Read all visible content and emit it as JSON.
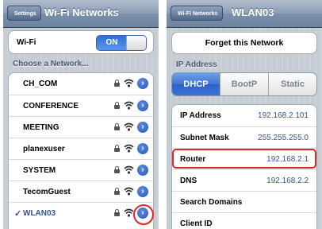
{
  "left": {
    "back_label": "Settings",
    "title": "Wi-Fi Networks",
    "wifi_label": "Wi-Fi",
    "wifi_toggle": "ON",
    "section_header": "Choose a Network...",
    "networks": [
      {
        "name": "CH_COM",
        "selected": false
      },
      {
        "name": "CONFERENCE",
        "selected": false
      },
      {
        "name": "MEETING",
        "selected": false
      },
      {
        "name": "planexuser",
        "selected": false
      },
      {
        "name": "SYSTEM",
        "selected": false
      },
      {
        "name": "TecomGuest",
        "selected": false
      },
      {
        "name": "WLAN03",
        "selected": true
      }
    ],
    "check_mark": "✓"
  },
  "right": {
    "back_label": "Wi-Fi Networks",
    "title": "WLAN03",
    "forget_button": "Forget this Network",
    "section_header": "IP Address",
    "segments": [
      "DHCP",
      "BootP",
      "Static"
    ],
    "active_segment": "DHCP",
    "rows": [
      {
        "label": "IP Address",
        "value": "192.168.2.101"
      },
      {
        "label": "Subnet Mask",
        "value": "255.255.255.0"
      },
      {
        "label": "Router",
        "value": "192.168.2.1"
      },
      {
        "label": "DNS",
        "value": "192.168.2.2"
      },
      {
        "label": "Search Domains",
        "value": ""
      },
      {
        "label": "Client ID",
        "value": ""
      }
    ]
  },
  "icons": {
    "lock": "lock-icon",
    "wifi": "wifi-signal-icon",
    "detail": "detail-disclosure-icon"
  },
  "colors": {
    "nav_bar": "#7b8fa9",
    "accent_blue": "#2f6fd6",
    "value_text": "#385487",
    "highlight_ring": "#e0252b"
  }
}
